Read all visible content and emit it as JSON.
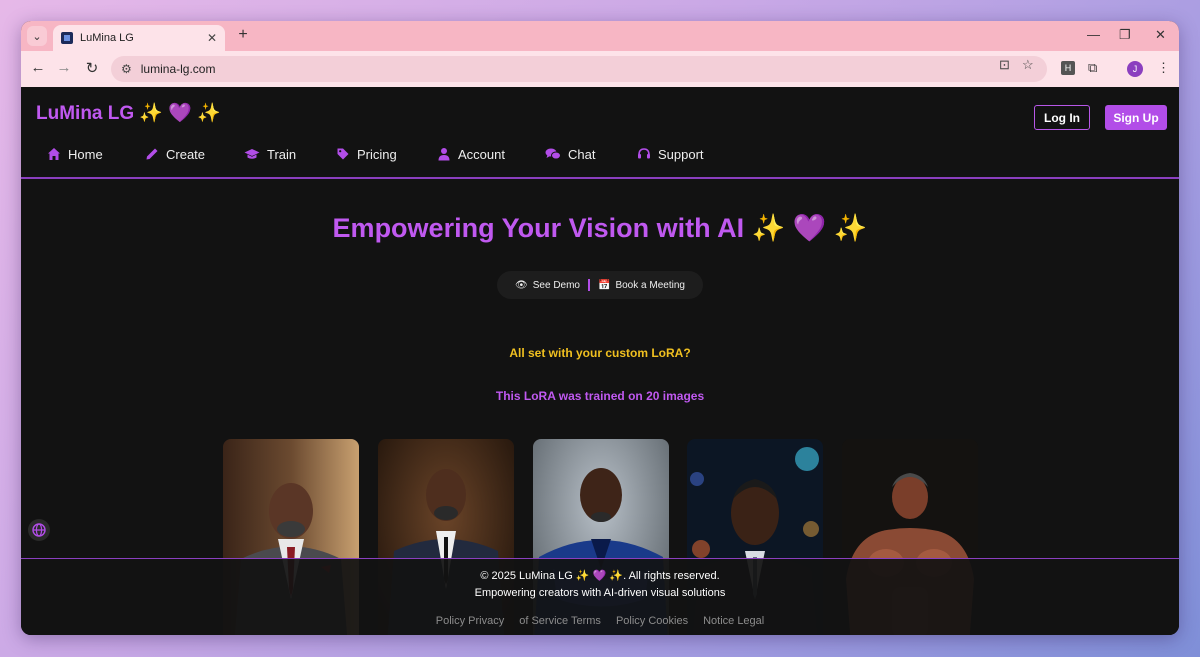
{
  "browser": {
    "tab_title": "LuMina LG",
    "tab_close": "✕",
    "new_tab": "+",
    "tab_menu": "⌄",
    "url": "lumina-lg.com",
    "profile_initial": "J",
    "ext_letter": "H",
    "minimize": "—",
    "restore": "❐",
    "close": "✕"
  },
  "header": {
    "brand": "LuMina LG ✨ 💜 ✨",
    "login_label": "Log In",
    "signup_label": "Sign Up"
  },
  "nav": [
    {
      "label": "Home",
      "icon": "home-icon"
    },
    {
      "label": "Create",
      "icon": "pencil-icon"
    },
    {
      "label": "Train",
      "icon": "graduation-cap-icon"
    },
    {
      "label": "Pricing",
      "icon": "tag-icon"
    },
    {
      "label": "Account",
      "icon": "user-icon"
    },
    {
      "label": "Chat",
      "icon": "chat-icon"
    },
    {
      "label": "Support",
      "icon": "headset-icon"
    }
  ],
  "hero": {
    "title": "Empowering Your Vision with AI ✨ 💜 ✨",
    "demo_label": "See Demo",
    "meeting_label": "Book a Meeting",
    "question": "All set with your custom LoRA?",
    "trained_info": "This LoRA was trained on 20 images"
  },
  "gallery": [
    {
      "name": "portrait-grey-suit-red-tie"
    },
    {
      "name": "portrait-navy-suit"
    },
    {
      "name": "portrait-blue-superhero-suit"
    },
    {
      "name": "portrait-dark-suit-city-night"
    },
    {
      "name": "portrait-muscular-bodybuilder"
    }
  ],
  "footer": {
    "copyright": "© 2025 LuMina LG ✨ 💜 ✨. All rights reserved.",
    "tagline": "Empowering creators with AI-driven visual solutions",
    "links": [
      "Policy Privacy",
      "of Service Terms",
      "Policy Cookies",
      "Notice Legal"
    ]
  },
  "colors": {
    "accent": "#c059f0",
    "button": "#b24de8",
    "highlight": "#f0c020",
    "background": "#121212"
  }
}
